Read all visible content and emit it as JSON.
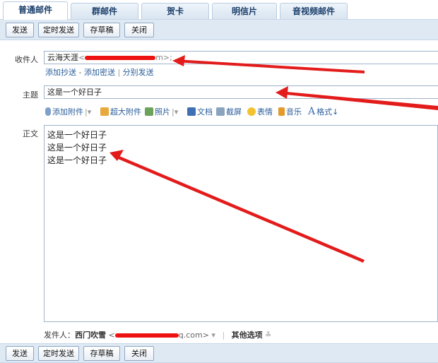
{
  "tabs": [
    "普通邮件",
    "群邮件",
    "贺卡",
    "明信片",
    "音视频邮件"
  ],
  "toolbar_top": [
    "发送",
    "定时发送",
    "存草稿",
    "关闭"
  ],
  "toolbar_bottom": [
    "发送",
    "定时发送",
    "存草稿",
    "关闭"
  ],
  "to": {
    "label": "收件人",
    "name": "云海天涯",
    "suffix_before": "<",
    "suffix_after": "m>;"
  },
  "links": {
    "cc": "添加抄送",
    "dash": " - ",
    "bcc": "添加密送",
    "sep": " | ",
    "split": "分别发送"
  },
  "subject": {
    "label": "主题",
    "value": "这是一个好日子"
  },
  "editor_tools": [
    {
      "label": "添加附件",
      "icon": "paperclip-icon"
    },
    {
      "label": "超大附件",
      "icon": "large-attachment-icon"
    },
    {
      "label": "照片",
      "icon": "photo-icon"
    },
    {
      "label": "文档",
      "icon": "word-doc-icon"
    },
    {
      "label": "截屏",
      "icon": "screenshot-icon"
    },
    {
      "label": "表情",
      "icon": "emoji-icon"
    },
    {
      "label": "音乐",
      "icon": "music-icon"
    },
    {
      "label": "格式↓",
      "icon": "format-icon"
    }
  ],
  "content": {
    "label": "正文",
    "lines": [
      "这是一个好日子",
      "这是一个好日子",
      "这是一个好日子"
    ]
  },
  "sender": {
    "label": "发件人：",
    "name": "西门吹雪",
    "email_prefix": "<",
    "email_suffix": "q.com>",
    "more": "其他选项"
  },
  "colors": {
    "accent": "#2a5d9a",
    "arrow": "#e31b1b",
    "bar": "#dfe9f4"
  }
}
